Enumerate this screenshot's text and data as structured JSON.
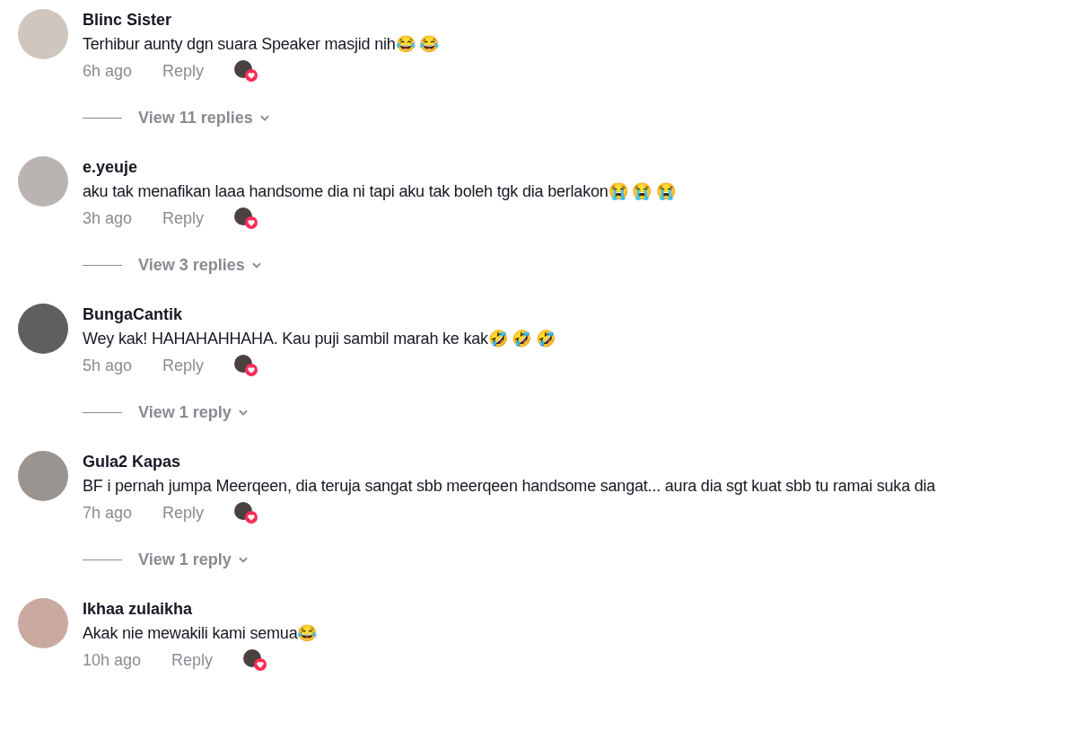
{
  "comments": [
    {
      "username": "Blinc Sister",
      "text": "Terhibur aunty dgn suara Speaker masjid nih😂 😂",
      "time": "6h ago",
      "reply": "Reply",
      "creator_liked": true,
      "view_replies": "View 11 replies"
    },
    {
      "username": "e.yeuje",
      "text": "aku tak menafikan laaa handsome dia ni tapi aku tak boleh tgk dia berlakon😭 😭 😭",
      "time": "3h ago",
      "reply": "Reply",
      "creator_liked": true,
      "view_replies": "View 3 replies"
    },
    {
      "username": "BungaCantik",
      "text": "Wey kak! HAHAHAHHAHA. Kau puji sambil marah ke kak🤣 🤣 🤣",
      "time": "5h ago",
      "reply": "Reply",
      "creator_liked": true,
      "view_replies": "View 1 reply"
    },
    {
      "username": "Gula2 Kapas",
      "text": "BF i pernah jumpa Meerqeen, dia teruja sangat sbb meerqeen handsome sangat... aura dia sgt kuat sbb tu ramai suka dia",
      "time": "7h ago",
      "reply": "Reply",
      "creator_liked": true,
      "view_replies": "View 1 reply"
    },
    {
      "username": "Ikhaa zulaikha",
      "text": "Akak nie mewakili kami semua😂",
      "time": "10h ago",
      "reply": "Reply",
      "creator_liked": true
    }
  ]
}
